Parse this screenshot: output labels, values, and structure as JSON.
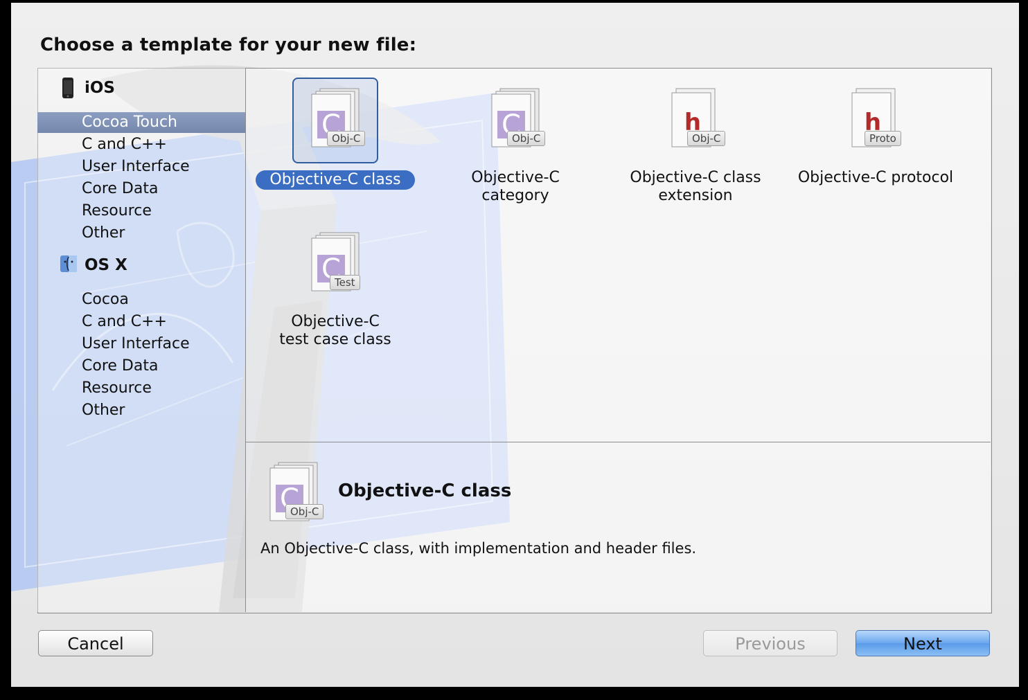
{
  "title": "Choose a template for your new file:",
  "sidebar": {
    "groups": [
      {
        "name": "iOS",
        "icon": "iphone-icon",
        "items": [
          "Cocoa Touch",
          "C and C++",
          "User Interface",
          "Core Data",
          "Resource",
          "Other"
        ],
        "selected": "Cocoa Touch"
      },
      {
        "name": "OS X",
        "icon": "finder-icon",
        "items": [
          "Cocoa",
          "C and C++",
          "User Interface",
          "Core Data",
          "Resource",
          "Other"
        ]
      }
    ]
  },
  "templates": [
    {
      "label": "Objective-C class",
      "tag": "Obj-C",
      "glyph": "C",
      "selected": true
    },
    {
      "label": "Objective-C category",
      "tag": "Obj-C",
      "glyph": "C"
    },
    {
      "label": "Objective-C class extension",
      "tag": "Obj-C",
      "glyph": "h"
    },
    {
      "label": "Objective-C protocol",
      "tag": "Proto",
      "glyph": "h"
    },
    {
      "label": "Objective-C test case class",
      "tag": "Test",
      "glyph": "C"
    }
  ],
  "description": {
    "title": "Objective-C class",
    "tag": "Obj-C",
    "glyph": "C",
    "text": "An Objective-C class, with implementation and header files."
  },
  "buttons": {
    "cancel": "Cancel",
    "previous": "Previous",
    "next": "Next"
  },
  "colors": {
    "selection_blue": "#3b6dc2",
    "sidebar_selection": "#7f91b6",
    "blueprint": "#9fbaf0"
  }
}
